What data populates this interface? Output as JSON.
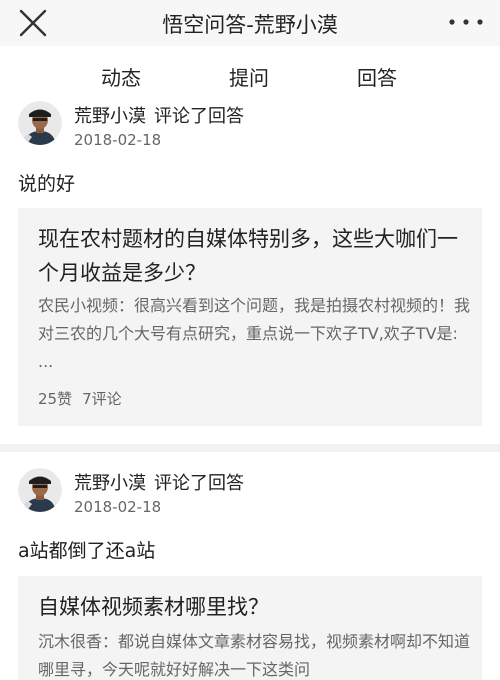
{
  "header": {
    "title": "悟空问答-荒野小漠"
  },
  "tabs": [
    {
      "label": "动态",
      "active": true
    },
    {
      "label": "提问",
      "active": false
    },
    {
      "label": "回答",
      "active": false
    }
  ],
  "colors": {
    "accent": "#e84b3c",
    "header_bg": "#f7f7f7",
    "card_bg": "#f4f4f4",
    "muted_text": "#666666"
  },
  "feed": [
    {
      "user": "荒野小漠",
      "action": "评论了回答",
      "date": "2018-02-18",
      "comment": "说的好",
      "question": {
        "title": "现在农村题材的自媒体特别多，这些大咖们一个月收益是多少？",
        "excerpt": "农民小视频：很高兴看到这个问题，我是拍摄农村视频的！我对三农的几个大号有点研究，重点说一下欢子TV,欢子TV是: ...",
        "likes": "25赞",
        "comments": "7评论"
      }
    },
    {
      "user": "荒野小漠",
      "action": "评论了回答",
      "date": "2018-02-18",
      "comment": "a站都倒了还a站",
      "question": {
        "title": "自媒体视频素材哪里找？",
        "excerpt": "沉木很香：都说自媒体文章素材容易找，视频素材啊却不知道哪里寻，今天呢就好好解决一下这类问"
      }
    }
  ]
}
